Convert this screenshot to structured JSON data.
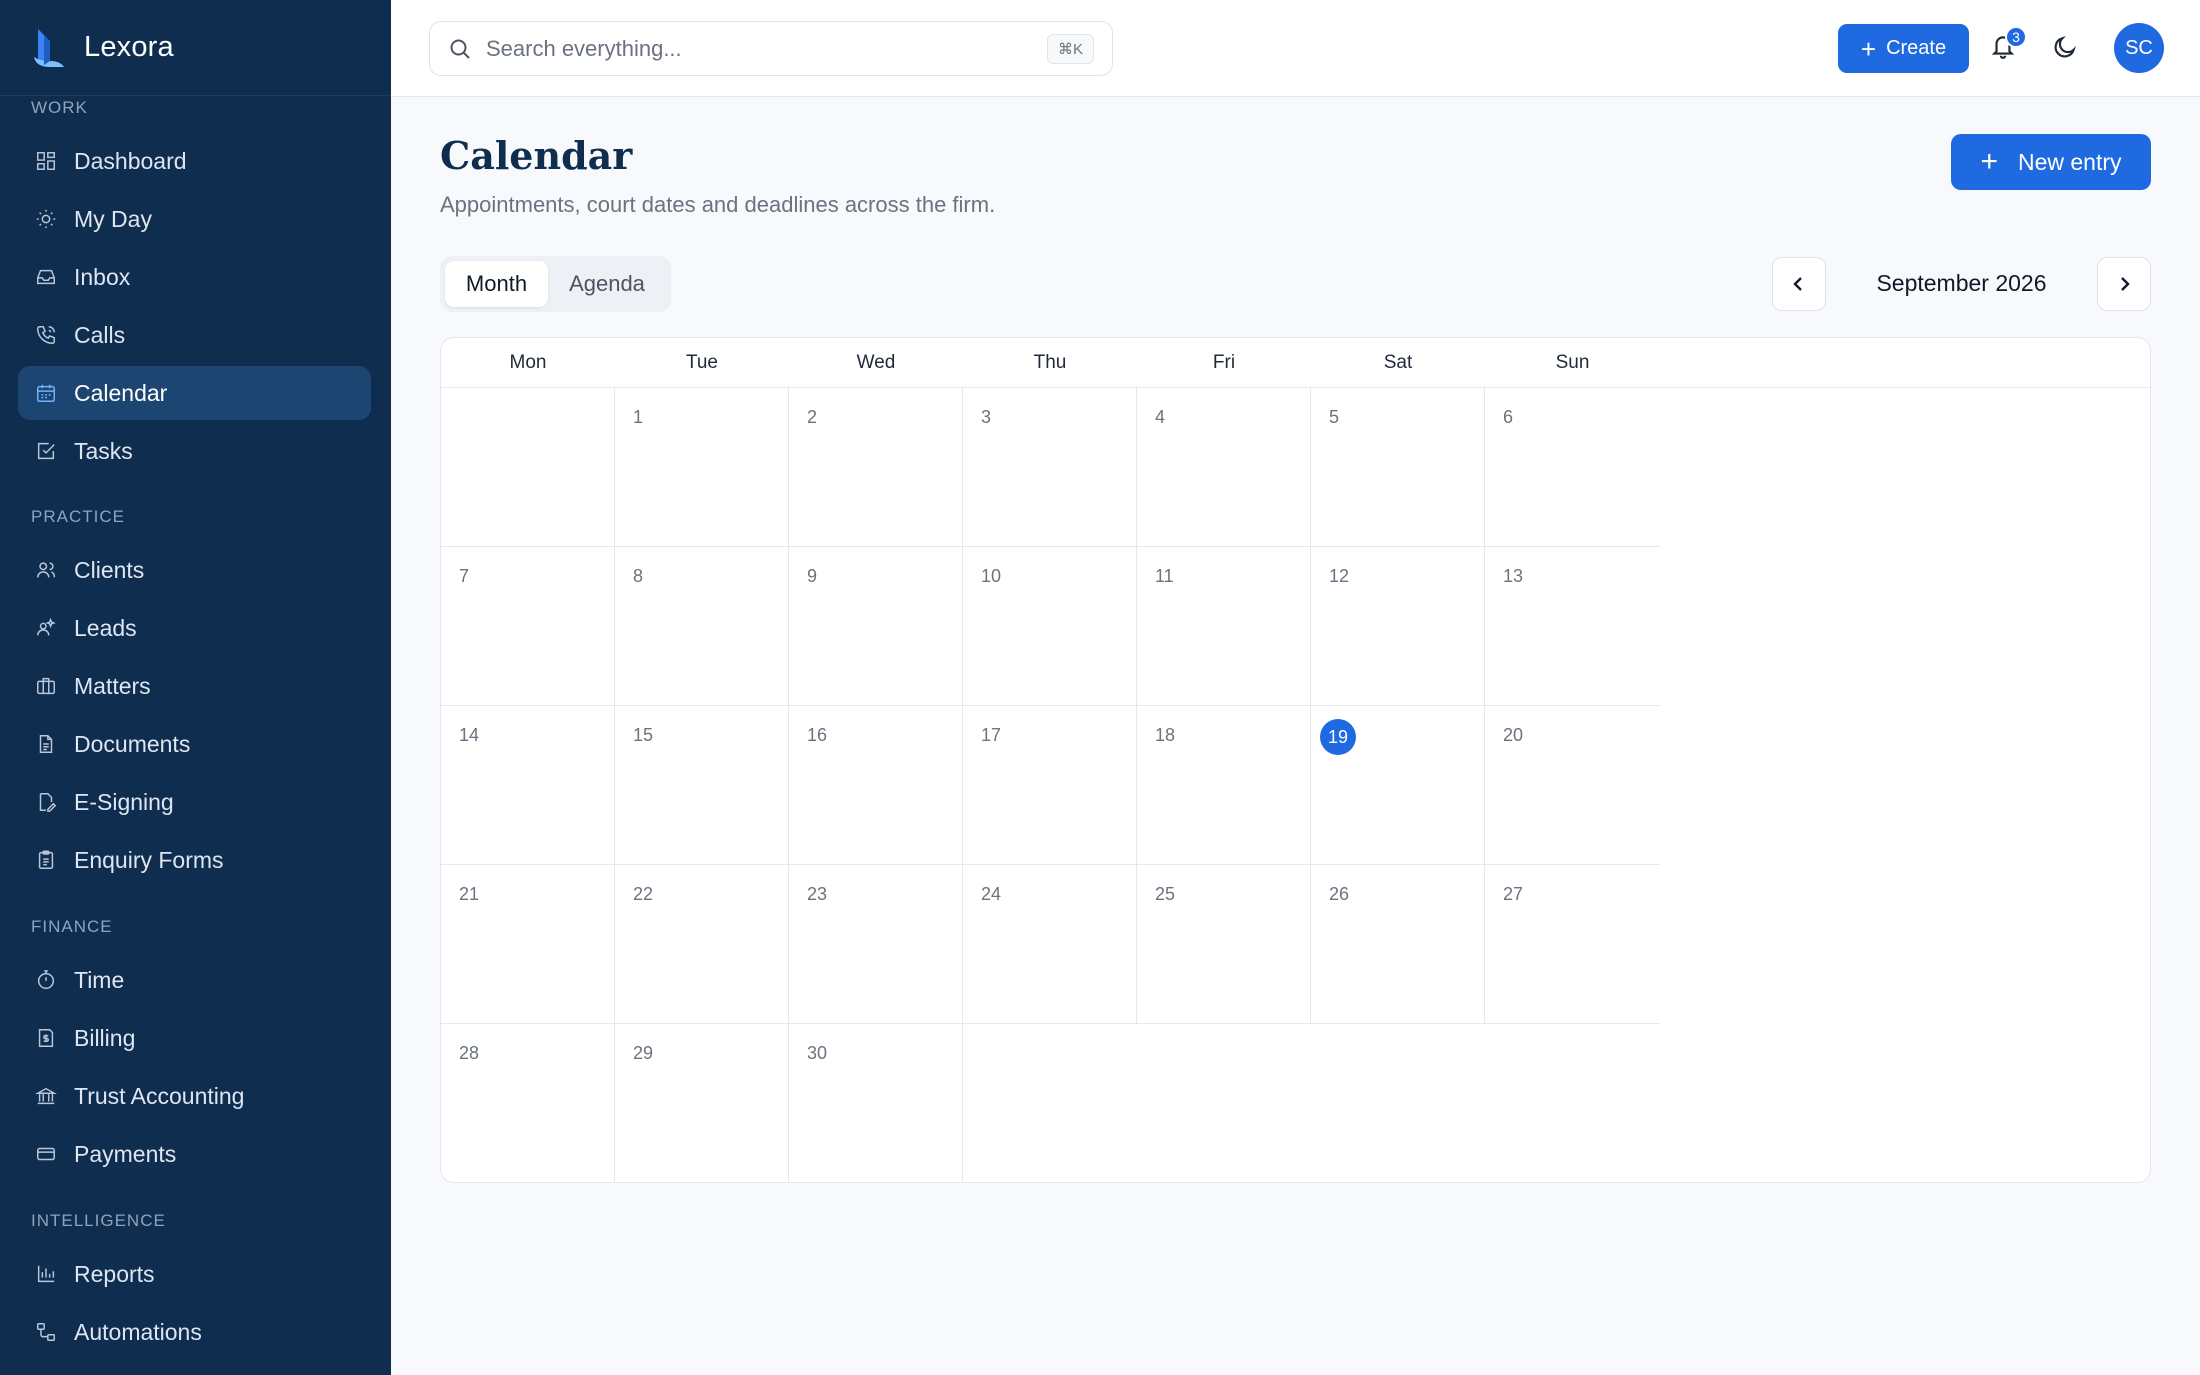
{
  "app": {
    "name": "Lexora"
  },
  "sidebar": {
    "groups": [
      {
        "label": "WORK",
        "items": [
          {
            "label": "Dashboard",
            "icon": "dashboard-icon"
          },
          {
            "label": "My Day",
            "icon": "sun-icon"
          },
          {
            "label": "Inbox",
            "icon": "inbox-icon"
          },
          {
            "label": "Calls",
            "icon": "phone-icon"
          },
          {
            "label": "Calendar",
            "icon": "calendar-icon",
            "active": true
          },
          {
            "label": "Tasks",
            "icon": "checkbox-icon"
          }
        ]
      },
      {
        "label": "PRACTICE",
        "items": [
          {
            "label": "Clients",
            "icon": "users-icon"
          },
          {
            "label": "Leads",
            "icon": "sparkle-user-icon"
          },
          {
            "label": "Matters",
            "icon": "briefcase-icon"
          },
          {
            "label": "Documents",
            "icon": "document-icon"
          },
          {
            "label": "E-Signing",
            "icon": "signature-icon"
          },
          {
            "label": "Enquiry Forms",
            "icon": "clipboard-icon"
          }
        ]
      },
      {
        "label": "FINANCE",
        "items": [
          {
            "label": "Time",
            "icon": "stopwatch-icon"
          },
          {
            "label": "Billing",
            "icon": "invoice-icon"
          },
          {
            "label": "Trust Accounting",
            "icon": "bank-icon"
          },
          {
            "label": "Payments",
            "icon": "card-icon"
          }
        ]
      },
      {
        "label": "INTELLIGENCE",
        "items": [
          {
            "label": "Reports",
            "icon": "bar-chart-icon"
          },
          {
            "label": "Automations",
            "icon": "workflow-icon"
          }
        ]
      }
    ]
  },
  "topbar": {
    "search_placeholder": "Search everything...",
    "search_shortcut": "⌘K",
    "create_label": "Create",
    "notifications_count": "3",
    "avatar_initials": "SC"
  },
  "page": {
    "title": "Calendar",
    "subtitle": "Appointments, court dates and deadlines across the firm.",
    "new_entry_label": "New entry"
  },
  "calendar": {
    "views": [
      "Month",
      "Agenda"
    ],
    "active_view": "Month",
    "month_label": "September 2026",
    "weekdays": [
      "Mon",
      "Tue",
      "Wed",
      "Thu",
      "Fri",
      "Sat",
      "Sun"
    ],
    "first_weekday_offset": 1,
    "days_in_month": 30,
    "today": 19
  },
  "colors": {
    "accent": "#1f6ae0",
    "sidebar": "#0f2d4f"
  }
}
